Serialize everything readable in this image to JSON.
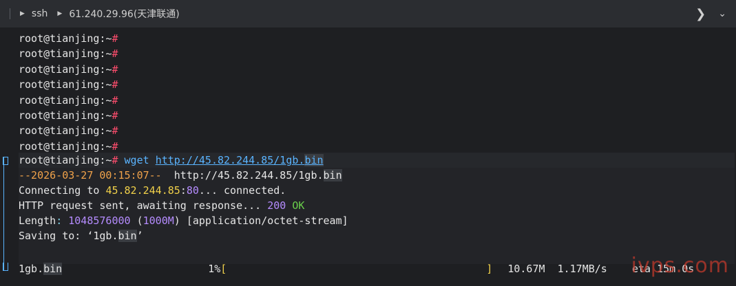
{
  "titlebar": {
    "crumb1": "ssh",
    "crumb2": "61.240.29.96(天津联通)",
    "chevron_right": ">",
    "chevron_down": "v"
  },
  "terminal": {
    "prompt": "root@tianjing:~",
    "hash": "#",
    "empty_prompt_count": 8,
    "command": {
      "cmd": "wget",
      "url_pre": "http://45.82.244.85/1gb.",
      "url_ext": "bin"
    },
    "output": {
      "ts_line": {
        "ts": "--2026-03-27 00:15:07--",
        "url_pre": "  http://45.82.244.85/1gb.",
        "url_ext": "bin"
      },
      "connecting": {
        "pre": "Connecting to ",
        "host": "45.82.244.85",
        "colon": ":",
        "port": "80",
        "post": "... connected."
      },
      "http": {
        "pre": "HTTP request sent, awaiting response... ",
        "code": "200",
        "status": " OK"
      },
      "length": {
        "label": "Length",
        "colon": ": ",
        "bytes": "1048576000",
        "human_open": " (",
        "human": "1000M",
        "human_close": ") [application/octet-stream]"
      },
      "saving": {
        "pre": "Saving to: ‘1gb.",
        "ext": "bin",
        "post": "’"
      }
    },
    "progress": {
      "filename_pre": "1gb.",
      "filename_ext": "bin",
      "percent": "1%",
      "bracket_open": "[",
      "bracket_close": "]",
      "downloaded": "10.67M",
      "speed": "1.17MB/s",
      "eta": "eta 15m 0s"
    }
  },
  "watermark": "ivps.com"
}
